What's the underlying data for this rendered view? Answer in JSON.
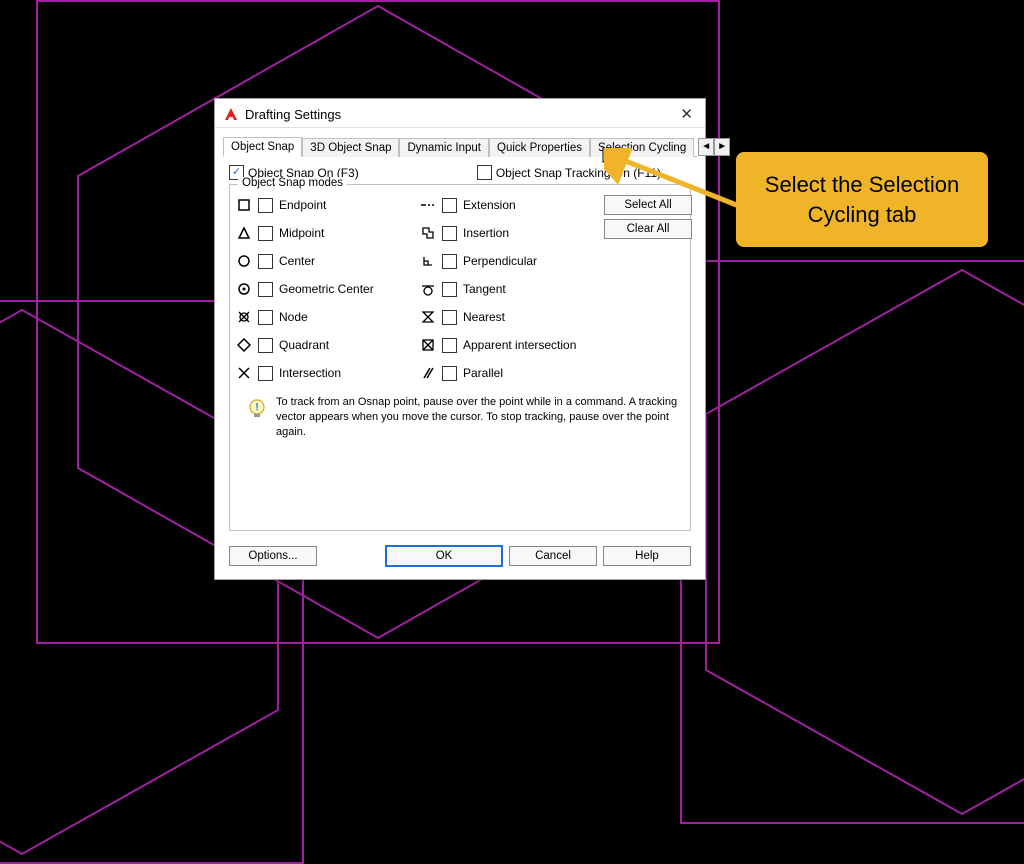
{
  "title": "Drafting Settings",
  "tabs": [
    {
      "label": "Object Snap",
      "active": true
    },
    {
      "label": "3D Object Snap",
      "active": false
    },
    {
      "label": "Dynamic Input",
      "active": false
    },
    {
      "label": "Quick Properties",
      "active": false
    },
    {
      "label": "Selection Cycling",
      "active": false
    }
  ],
  "osnap_on_label": "Object Snap On (F3)",
  "osnap_on_checked": true,
  "osnap_track_label": "Object Snap Tracking On (F11)",
  "osnap_track_checked": false,
  "modes_legend": "Object Snap modes",
  "left_modes": [
    {
      "label": "Endpoint"
    },
    {
      "label": "Midpoint"
    },
    {
      "label": "Center"
    },
    {
      "label": "Geometric Center"
    },
    {
      "label": "Node"
    },
    {
      "label": "Quadrant"
    },
    {
      "label": "Intersection"
    }
  ],
  "right_modes": [
    {
      "label": "Extension"
    },
    {
      "label": "Insertion"
    },
    {
      "label": "Perpendicular"
    },
    {
      "label": "Tangent"
    },
    {
      "label": "Nearest"
    },
    {
      "label": "Apparent intersection"
    },
    {
      "label": "Parallel"
    }
  ],
  "select_all": "Select All",
  "clear_all": "Clear All",
  "tip_text": "To track from an Osnap point, pause over the point while in a command.  A tracking vector appears when you move the cursor.  To stop tracking, pause over the point again.",
  "options_btn": "Options...",
  "ok": "OK",
  "cancel": "Cancel",
  "help": "Help",
  "callout_text": "Select the Selection Cycling tab"
}
